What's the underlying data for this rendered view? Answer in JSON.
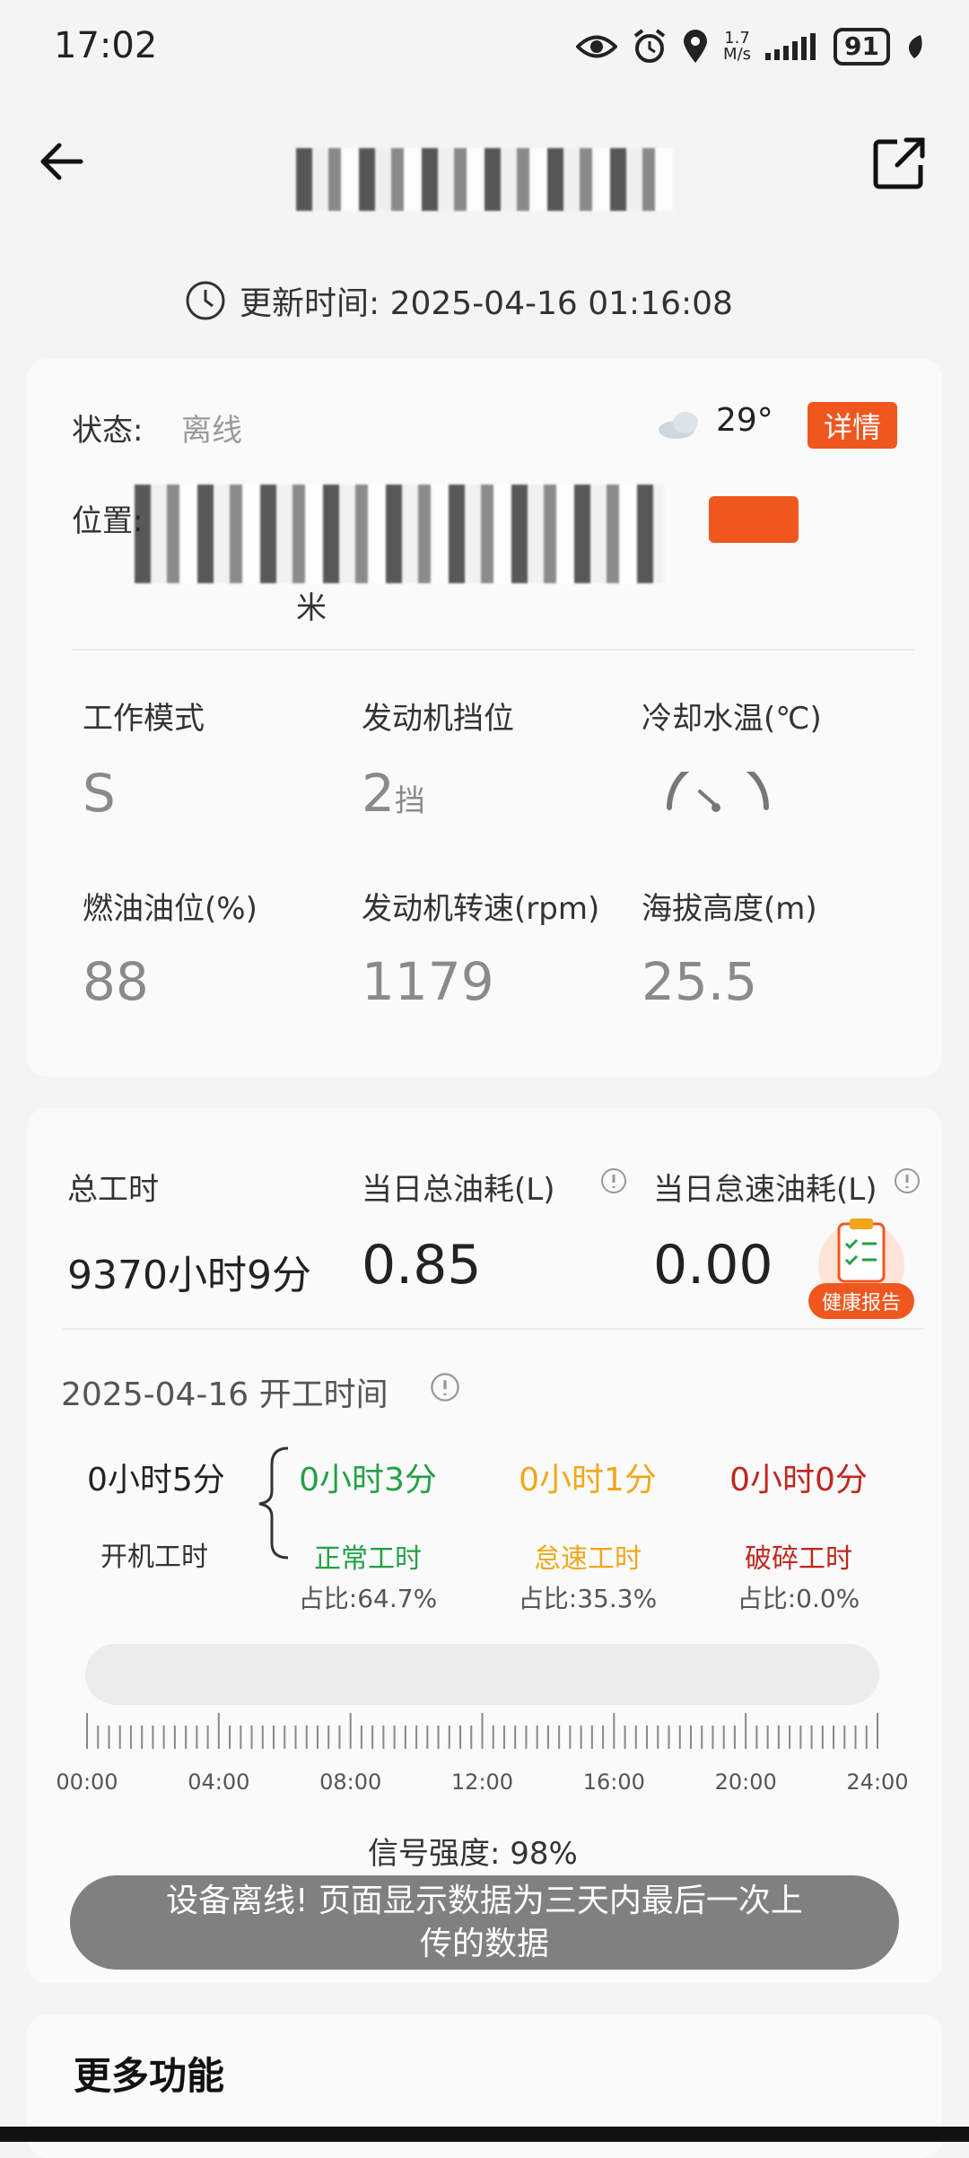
{
  "status_bar": {
    "time": "17:02",
    "net_speed_value": "1.7",
    "net_speed_unit": "M/s",
    "battery": "91"
  },
  "header": {
    "update_time": "更新时间: 2025-04-16 01:16:08"
  },
  "status_card": {
    "status_label": "状态:",
    "status_value": "离线",
    "temperature": "29°",
    "detail_button": "详情",
    "location_label": "位置:",
    "location_distance_suffix": "米"
  },
  "metrics": [
    {
      "label": "工作模式",
      "value": "S",
      "unit": ""
    },
    {
      "label": "发动机挡位",
      "value": "2",
      "unit": "挡"
    },
    {
      "label": "冷却水温(℃)",
      "value": "",
      "unit": ""
    },
    {
      "label": "燃油油位(%)",
      "value": "88",
      "unit": ""
    },
    {
      "label": "发动机转速(rpm)",
      "value": "1179",
      "unit": ""
    },
    {
      "label": "海拔高度(m)",
      "value": "25.5",
      "unit": ""
    }
  ],
  "totals": {
    "total_hours_label": "总工时",
    "total_hours_value": "9370小时9分",
    "day_fuel_label": "当日总油耗(L)",
    "day_fuel_value": "0.85",
    "idle_fuel_label": "当日怠速油耗(L)",
    "idle_fuel_value": "0.00",
    "health_report_label": "健康报告"
  },
  "work_time": {
    "title": "2025-04-16 开工时间",
    "on_time_value": "0小时5分",
    "on_time_label": "开机工时",
    "normal_value": "0小时3分",
    "normal_label": "正常工时",
    "normal_ratio": "占比:64.7%",
    "idle_value": "0小时1分",
    "idle_label": "怠速工时",
    "idle_ratio": "占比:35.3%",
    "break_value": "0小时0分",
    "break_label": "破碎工时",
    "break_ratio": "占比:0.0%",
    "hours": [
      "00:00",
      "04:00",
      "08:00",
      "12:00",
      "16:00",
      "20:00",
      "24:00"
    ],
    "signal": "信号强度: 98%"
  },
  "toast": {
    "line1": "设备离线! 页面显示数据为三天内最后一次上",
    "line2": "传的数据"
  },
  "more": {
    "title": "更多功能"
  },
  "colors": {
    "accent": "#f0571f",
    "green": "#22a045",
    "yellow": "#f0a71a",
    "red": "#c0261e"
  }
}
